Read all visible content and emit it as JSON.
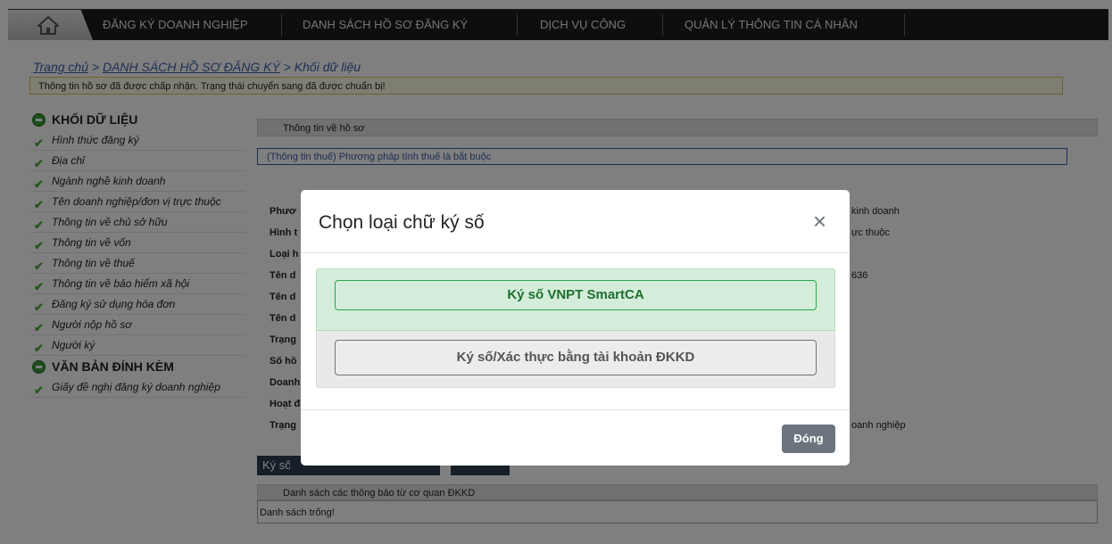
{
  "nav": {
    "home_icon": "home-icon",
    "items": [
      {
        "label": "ĐĂNG KÝ DOANH NGHIỆP"
      },
      {
        "label": "DANH SÁCH HỒ SƠ ĐĂNG KÝ"
      },
      {
        "label": "DỊCH VỤ CÔNG"
      },
      {
        "label": "QUẢN LÝ THÔNG TIN CÁ NHÂN"
      }
    ]
  },
  "breadcrumb": {
    "home": "Trang chủ",
    "sep1": " > ",
    "list": "DANH SÁCH HỒ SƠ ĐĂNG KÝ",
    "sep2": " > ",
    "current": "Khối dữ liệu"
  },
  "notice": "Thông tin hồ sơ đã được chấp nhận. Trạng thái chuyển sang đã được chuẩn bị!",
  "sidebar": {
    "section1_title": "KHỐI DỮ LIỆU",
    "section1_items": [
      {
        "label": "Hình thức đăng ký"
      },
      {
        "label": "Địa chỉ"
      },
      {
        "label": "Ngành nghề kinh doanh"
      },
      {
        "label": "Tên doanh nghiệp/đơn vị trực thuộc"
      },
      {
        "label": "Thông tin về chủ sở hữu"
      },
      {
        "label": "Thông tin về vốn"
      },
      {
        "label": "Thông tin về thuế"
      },
      {
        "label": "Thông tin về bảo hiểm xã hội"
      },
      {
        "label": "Đăng ký sử dụng hóa đơn"
      },
      {
        "label": "Người nộp hồ sơ"
      },
      {
        "label": "Người ký"
      }
    ],
    "section2_title": "VĂN BẢN ĐÍNH KÈM",
    "section2_items": [
      {
        "label": "Giấy đề nghị đăng ký doanh nghiệp"
      }
    ]
  },
  "main": {
    "panel_title": "Thông tin về hồ sơ",
    "tax_note": "(Thông tin thuế) Phương pháp tính thuế là bắt buộc",
    "fields": [
      {
        "label": "Phươ",
        "value": "kinh doanh"
      },
      {
        "label": "Hình t",
        "value": "ực thuộc"
      },
      {
        "label": "Loại h",
        "value": ""
      },
      {
        "label": "Tên d",
        "value": "636"
      },
      {
        "label": "Tên d",
        "value": ""
      },
      {
        "label": "Tên d",
        "value": ""
      },
      {
        "label": "Trạng",
        "value": ""
      },
      {
        "label": "Số hồ",
        "value": ""
      },
      {
        "label": "Doanh",
        "value": ""
      },
      {
        "label": "Hoạt đ",
        "value": ""
      },
      {
        "label": "Trạng",
        "value": "oanh nghiệp"
      }
    ],
    "btn_sign": "Ký số",
    "notices_title": "Danh sách các thông báo từ cơ quan ĐKKD",
    "notices_empty": "Danh sách trống!"
  },
  "modal": {
    "title": "Chọn loại chữ ký số",
    "close_glyph": "×",
    "option1": "Ký số VNPT SmartCA",
    "option2": "Ký số/Xác thực bằng tài khoản ĐKKD",
    "close_label": "Đóng"
  }
}
